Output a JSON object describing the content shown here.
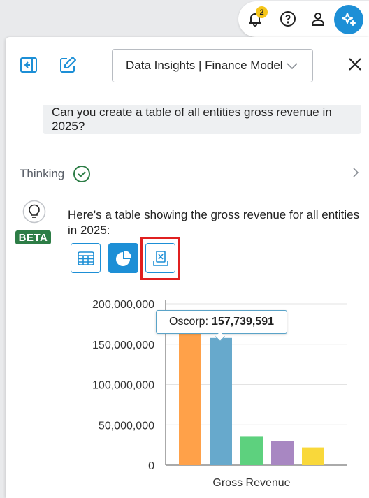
{
  "topbar": {
    "notification_count": "2",
    "icons": [
      "bell-icon",
      "help-icon",
      "user-icon",
      "ai-sparkle-icon"
    ]
  },
  "header": {
    "model_select_value": "Data Insights | Finance Model"
  },
  "conversation": {
    "user_message": "Can you create a table of all entities gross revenue in 2025?",
    "thinking_label": "Thinking",
    "beta_label": "BETA",
    "answer_text": "Here's a table showing the gross revenue for all entities in 2025:"
  },
  "tooltip": {
    "label": "Oscorp:",
    "value": "157,739,591"
  },
  "colors": {
    "accent": "#1d8fd6",
    "beta_green": "#2d7d46",
    "highlight_red": "#e02020"
  },
  "chart_data": {
    "type": "bar",
    "categories": [
      "Gross Revenue"
    ],
    "xlabel": "Gross Revenue",
    "ylim": [
      0,
      200000000
    ],
    "yticks": [
      "0",
      "50,000,000",
      "100,000,000",
      "150,000,000",
      "200,000,000"
    ],
    "ytick_values": [
      0,
      50000000,
      100000000,
      150000000,
      200000000
    ],
    "series": [
      {
        "values": [
          175000000
        ],
        "color": "#ffa149"
      },
      {
        "name": "Oscorp",
        "values": [
          157739591
        ],
        "color": "#67a9cc"
      },
      {
        "values": [
          36000000
        ],
        "color": "#5dd17e"
      },
      {
        "values": [
          30000000
        ],
        "color": "#a887c2"
      },
      {
        "values": [
          22000000
        ],
        "color": "#f9d83a"
      }
    ],
    "grid": true
  }
}
